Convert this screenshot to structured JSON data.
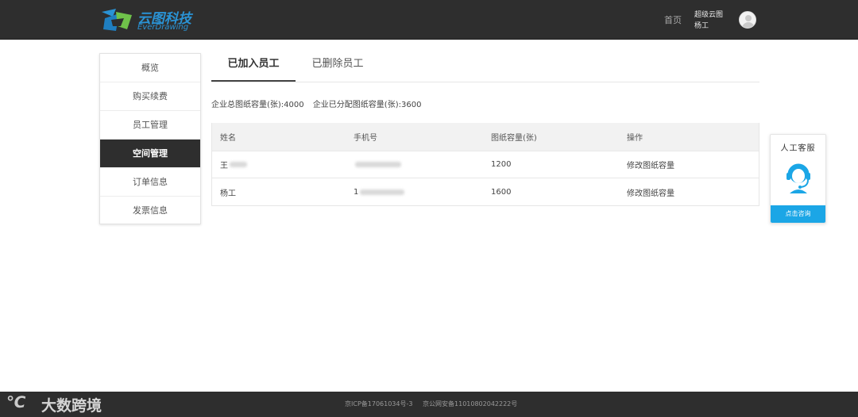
{
  "header": {
    "logo_cn": "云图科技",
    "logo_en": "EverDrawing",
    "home_link": "首页",
    "user_role": "超级云图",
    "user_name": "杨工"
  },
  "sidebar": {
    "items": [
      {
        "label": "概览",
        "active": false
      },
      {
        "label": "购买续费",
        "active": false
      },
      {
        "label": "员工管理",
        "active": false
      },
      {
        "label": "空间管理",
        "active": true
      },
      {
        "label": "订单信息",
        "active": false
      },
      {
        "label": "发票信息",
        "active": false
      }
    ]
  },
  "tabs": [
    {
      "label": "已加入员工",
      "active": true
    },
    {
      "label": "已删除员工",
      "active": false
    }
  ],
  "capacity": {
    "total": "企业总图纸容量(张):4000",
    "assigned": "企业已分配图纸容量(张):3600"
  },
  "table": {
    "headers": [
      "姓名",
      "手机号",
      "图纸容量(张)",
      "操作"
    ],
    "rows": [
      {
        "name": "王",
        "phone": "",
        "capacity": "1200",
        "action": "修改图纸容量"
      },
      {
        "name": "杨工",
        "phone": "1",
        "capacity": "1600",
        "action": "修改图纸容量"
      }
    ]
  },
  "customer_service": {
    "title": "人工客服",
    "button": "点击咨询",
    "icon": "headset-agent-icon"
  },
  "footer": {
    "icp": "京ICP备17061034号-3",
    "police": "京公网安备11010802042222号"
  },
  "watermark": {
    "mark": "℃",
    "text": "大数跨境"
  },
  "colors": {
    "topbar": "#2e2e2e",
    "accent": "#1ba6e6",
    "brand": "#2a93d5",
    "active_sidebar": "#2e2e2e"
  }
}
